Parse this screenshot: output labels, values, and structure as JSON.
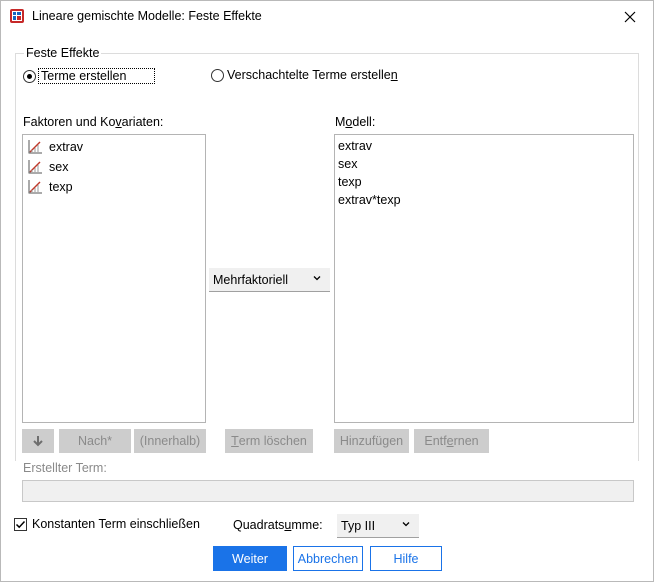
{
  "window": {
    "title": "Lineare gemischte Modelle: Feste Effekte",
    "close_glyph": "✕"
  },
  "group": {
    "label": "Feste Effekte",
    "radio_build": "Terme erstellen",
    "radio_nested_prefix": "Verschachtelte Terme erstelle",
    "radio_nested_mnemonic": "n"
  },
  "factors": {
    "label_prefix": "Faktoren und Ko",
    "label_mnemonic": "v",
    "label_suffix": "ariaten:",
    "items": [
      "extrav",
      "sex",
      "texp"
    ]
  },
  "model": {
    "label_prefix": "M",
    "label_mnemonic": "o",
    "label_suffix": "dell:",
    "items": [
      "extrav",
      "sex",
      "texp",
      "extrav*texp"
    ]
  },
  "term_type": {
    "selected": "Mehrfaktoriell"
  },
  "buttons": {
    "arrow_glyph": "🡇",
    "by": "Nach*",
    "within": "(Innerhalb)",
    "clear_prefix": "",
    "clear_mnemonic": "T",
    "clear_suffix": "erm löschen",
    "add": "Hinzufügen",
    "remove_prefix": "Entf",
    "remove_mnemonic": "e",
    "remove_suffix": "rnen"
  },
  "built_term": {
    "label": "Erstellter Term:",
    "value": ""
  },
  "intercept": {
    "label": "Konstanten Term einschließen",
    "checked": true
  },
  "sum_of_squares": {
    "label_prefix": "Quadrats",
    "label_mnemonic": "u",
    "label_suffix": "mme:",
    "selected": "Typ III"
  },
  "footer": {
    "continue": "Weiter",
    "cancel": "Abbrechen",
    "help": "Hilfe"
  },
  "colors": {
    "accent": "#1a73e8",
    "disabled_bg": "#cdcdcd",
    "disabled_text": "#8a8a8a",
    "scale_icon": "#c0392b"
  }
}
